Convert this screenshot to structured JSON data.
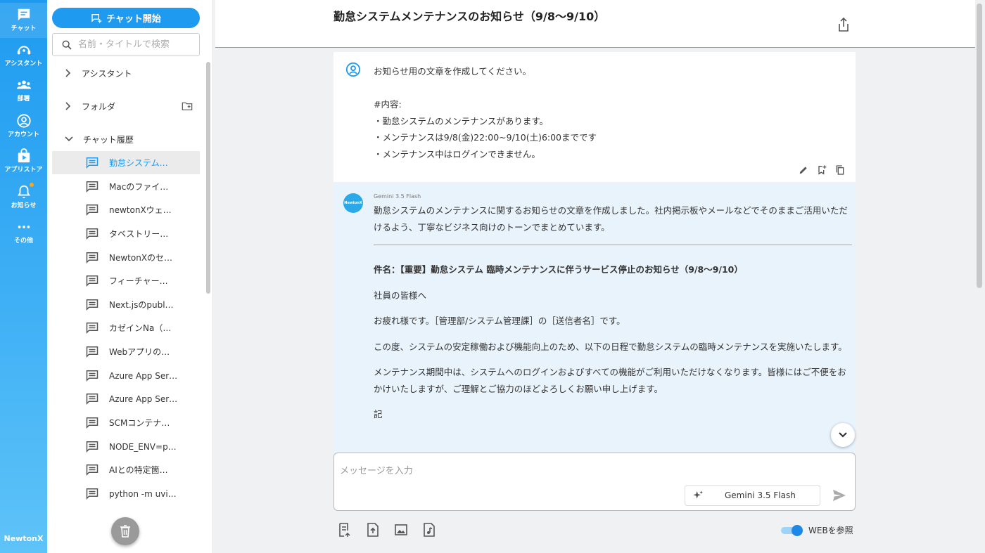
{
  "rail": {
    "items": [
      {
        "label": "チャット",
        "icon": "chat-icon"
      },
      {
        "label": "アシスタント",
        "icon": "assistant-icon"
      },
      {
        "label": "部署",
        "icon": "department-icon"
      },
      {
        "label": "アカウント",
        "icon": "account-icon"
      },
      {
        "label": "アプリストア",
        "icon": "appstore-icon"
      },
      {
        "label": "お知らせ",
        "icon": "bell-icon"
      },
      {
        "label": "その他",
        "icon": "more-icon"
      }
    ],
    "brand": "NewtonX"
  },
  "sidebar": {
    "new_chat_label": "チャット開始",
    "search_placeholder": "名前・タイトルで検索",
    "sections": {
      "assistant": "アシスタント",
      "folder": "フォルダ",
      "history": "チャット履歴"
    },
    "history": [
      "勤怠システム…",
      "Macのファイ…",
      "newtonXウェ…",
      "タベストリー…",
      "NewtonXのセ…",
      "フィーチャー…",
      "Next.jsのpubl…",
      "カゼインNa（…",
      "Webアプリの…",
      "Azure App Ser…",
      "Azure App Ser…",
      "SCMコンテナ…",
      "NODE_ENV=p…",
      "AIとの特定箇…",
      "python -m uvi…"
    ]
  },
  "header": {
    "title": "勤怠システムメンテナンスのお知らせ（9/8〜9/10）"
  },
  "user_message": {
    "lines": [
      "お知らせ用の文章を作成してください。",
      "",
      "#内容:",
      "・勤怠システムのメンテナンスがあります。",
      "・メンテナンスは9/8(金)22:00~9/10(土)6:00までです",
      "・メンテナンス中はログインできません。"
    ]
  },
  "ai_message": {
    "avatar_text": "NewtonX",
    "model": "Gemini 3.5 Flash",
    "intro": "勤怠システムのメンテナンスに関するお知らせの文章を作成しました。社内掲示板やメールなどでそのままご活用いただけるよう、丁寧なビジネス向けのトーンでまとめています。",
    "subject": "件名：【重要】勤怠システム 臨時メンテナンスに伴うサービス停止のお知らせ（9/8〜9/10）",
    "paragraphs": [
      "社員の皆様へ",
      "お疲れ様です。［管理部/システム管理課］の［送信者名］です。",
      "この度、システムの安定稼働および機能向上のため、以下の日程で勤怠システムの臨時メンテナンスを実施いたします。",
      "メンテナンス期間中は、システムへのログインおよびすべての機能がご利用いただけなくなります。皆様にはご不便をおかけいたしますが、ご理解とご協力のほどよろしくお願い申し上げます。",
      "記"
    ]
  },
  "composer": {
    "placeholder": "メッセージを入力",
    "model_label": "Gemini 3.5 Flash",
    "web_label": "WEBを参照",
    "web_enabled": true
  },
  "colors": {
    "accent": "#1e9bf0",
    "ai_bg": "#e9f3fc",
    "notification_dot": "#f5a623"
  }
}
